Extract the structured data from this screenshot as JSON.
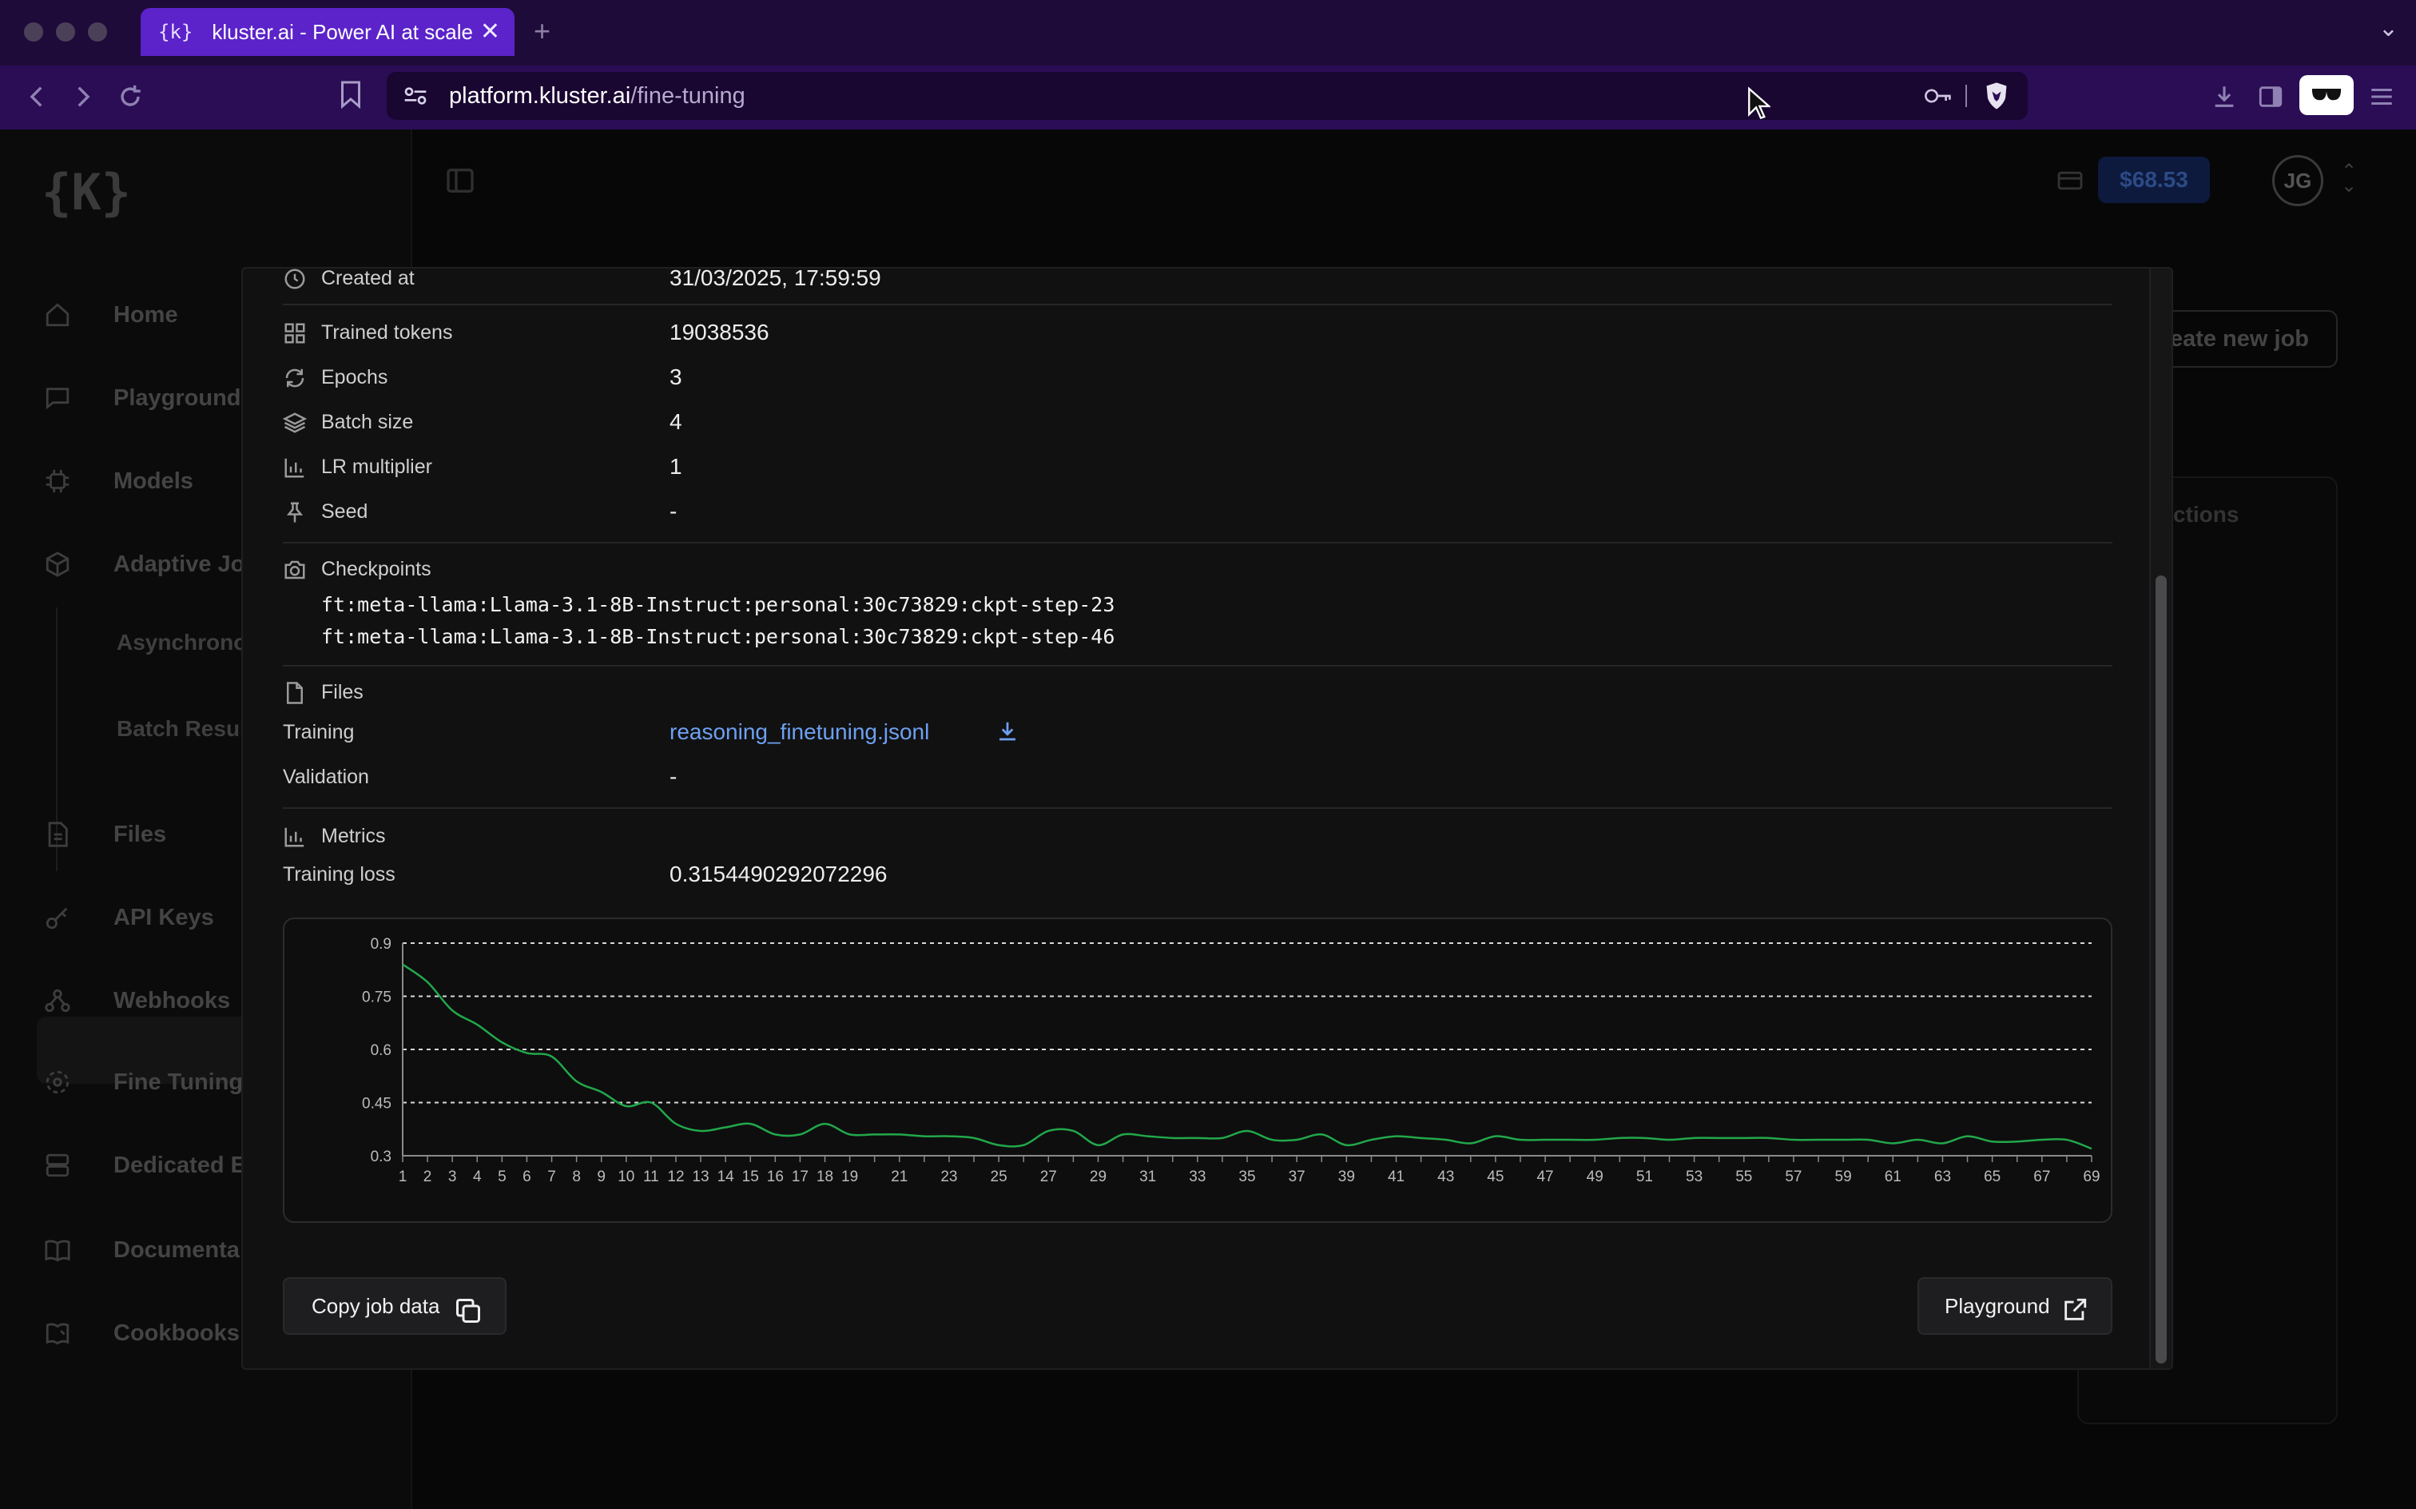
{
  "browser": {
    "tab_favicon": "{k}",
    "tab_title": "kluster.ai - Power AI at scale",
    "tab_close": "✕",
    "new_tab": "+",
    "tabs_menu": "⌄",
    "url_host": "platform.kluster.ai",
    "url_path": "/fine-tuning",
    "accent_color": "#5b23c9",
    "toolbar_color": "#2a0d55"
  },
  "sidebar": {
    "logo": "{K}",
    "items": [
      {
        "label": "Home",
        "icon": "home-icon"
      },
      {
        "label": "Playground",
        "icon": "chat-icon"
      },
      {
        "label": "Models",
        "icon": "models-icon"
      },
      {
        "label": "Adaptive Jo",
        "icon": "cube-icon"
      },
      {
        "label": "Files",
        "icon": "file-icon"
      },
      {
        "label": "API Keys",
        "icon": "key-icon"
      },
      {
        "label": "Webhooks",
        "icon": "webhook-icon"
      },
      {
        "label": "Fine Tuning",
        "icon": "fine-tuning-icon"
      },
      {
        "label": "Dedicated E",
        "icon": "server-icon"
      },
      {
        "label": "Documenta",
        "icon": "book-icon"
      },
      {
        "label": "Cookbooks",
        "icon": "cookbook-icon"
      }
    ],
    "sub_items": [
      "Asynchrono",
      "Batch Resul"
    ]
  },
  "header": {
    "balance": "$68.53",
    "avatar_initials": "JG",
    "create_job": "eate new job",
    "bg_actions": "ctions"
  },
  "job": {
    "created_at": {
      "label": "Created at",
      "value": "31/03/2025, 17:59:59"
    },
    "details": [
      {
        "label": "Trained tokens",
        "value": "19038536",
        "icon": "grid-icon"
      },
      {
        "label": "Epochs",
        "value": "3",
        "icon": "refresh-icon"
      },
      {
        "label": "Batch size",
        "value": "4",
        "icon": "layers-icon"
      },
      {
        "label": "LR multiplier",
        "value": "1",
        "icon": "bar-chart-icon"
      },
      {
        "label": "Seed",
        "value": "-",
        "icon": "pin-icon"
      }
    ],
    "checkpoints": {
      "label": "Checkpoints",
      "items": [
        "ft:meta-llama:Llama-3.1-8B-Instruct:personal:30c73829:ckpt-step-23",
        "ft:meta-llama:Llama-3.1-8B-Instruct:personal:30c73829:ckpt-step-46"
      ]
    },
    "files": {
      "label": "Files",
      "training_label": "Training",
      "training_file": "reasoning_finetuning.jsonl",
      "validation_label": "Validation",
      "validation_value": "-"
    },
    "metrics": {
      "label": "Metrics",
      "training_loss_label": "Training loss",
      "training_loss_value": "0.3154490292072296"
    }
  },
  "buttons": {
    "copy_job_data": "Copy job data",
    "playground": "Playground"
  },
  "chart_data": {
    "type": "line",
    "title": "",
    "xlabel": "",
    "ylabel": "",
    "ylim": [
      0.3,
      0.9
    ],
    "yticks": [
      0.9,
      0.75,
      0.6,
      0.45,
      0.3
    ],
    "ytick_labels": [
      "0.9",
      "0.75",
      "0.6",
      "0.45",
      "0.3"
    ],
    "x_tick_labels": [
      1,
      2,
      3,
      4,
      5,
      6,
      7,
      8,
      9,
      10,
      11,
      12,
      13,
      14,
      15,
      16,
      17,
      18,
      19,
      21,
      23,
      25,
      27,
      29,
      31,
      33,
      35,
      37,
      39,
      41,
      43,
      45,
      47,
      49,
      51,
      53,
      55,
      57,
      59,
      61,
      63,
      65,
      67,
      69
    ],
    "grid": "dashed horizontal",
    "line_color": "#22a84a",
    "series": [
      {
        "x": [
          1,
          2,
          3,
          4,
          5,
          6,
          7,
          8,
          9,
          10,
          11,
          12,
          13,
          14,
          15,
          16,
          17,
          18,
          19,
          20,
          21,
          22,
          23,
          24,
          25,
          26,
          27,
          28,
          29,
          30,
          31,
          32,
          33,
          34,
          35,
          36,
          37,
          38,
          39,
          40,
          41,
          42,
          43,
          44,
          45,
          46,
          47,
          48,
          49,
          50,
          51,
          52,
          53,
          54,
          55,
          56,
          57,
          58,
          59,
          60,
          61,
          62,
          63,
          64,
          65,
          66,
          67,
          68,
          69
        ],
        "values": [
          0.84,
          0.79,
          0.71,
          0.67,
          0.62,
          0.59,
          0.58,
          0.51,
          0.48,
          0.44,
          0.45,
          0.39,
          0.37,
          0.38,
          0.39,
          0.36,
          0.36,
          0.39,
          0.36,
          0.36,
          0.36,
          0.355,
          0.355,
          0.35,
          0.33,
          0.33,
          0.37,
          0.37,
          0.33,
          0.36,
          0.355,
          0.35,
          0.35,
          0.35,
          0.37,
          0.345,
          0.345,
          0.36,
          0.33,
          0.345,
          0.355,
          0.35,
          0.345,
          0.335,
          0.355,
          0.345,
          0.345,
          0.345,
          0.345,
          0.35,
          0.35,
          0.345,
          0.35,
          0.35,
          0.35,
          0.35,
          0.345,
          0.345,
          0.345,
          0.345,
          0.335,
          0.345,
          0.335,
          0.355,
          0.34,
          0.34,
          0.345,
          0.345,
          0.32
        ]
      }
    ]
  }
}
